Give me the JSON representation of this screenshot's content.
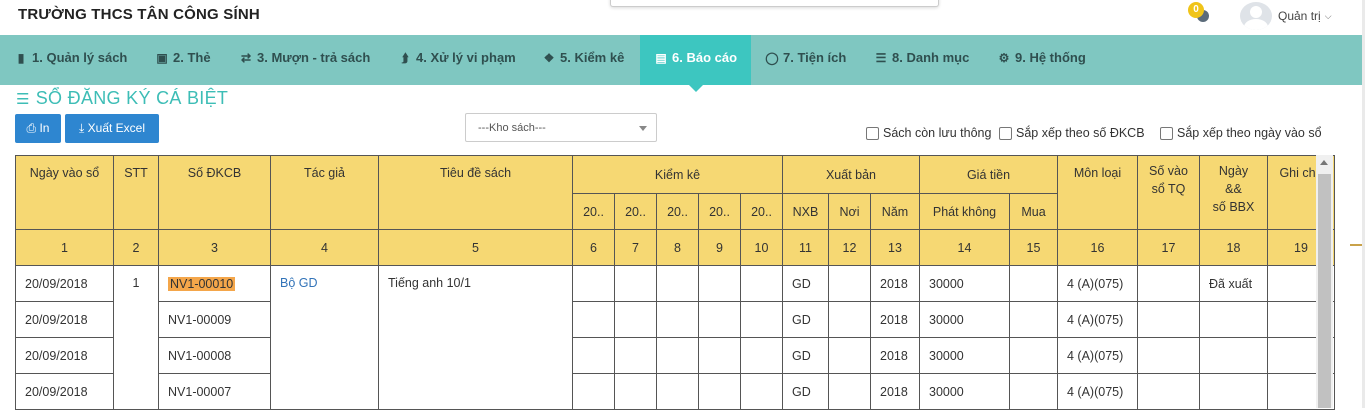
{
  "app": {
    "school_name": "TRƯỜNG THCS TÂN CÔNG SÍNH"
  },
  "header": {
    "notification_count": "0",
    "user_name": "Quản trị"
  },
  "nav": {
    "items": [
      {
        "label": "1. Quản lý sách",
        "icon": "book-icon"
      },
      {
        "label": "2. Thẻ",
        "icon": "card-icon"
      },
      {
        "label": "3. Mượn - trả sách",
        "icon": "exchange-icon"
      },
      {
        "label": "4. Xử lý vi phạm",
        "icon": "bolt-icon"
      },
      {
        "label": "5. Kiểm kê",
        "icon": "cubes-icon"
      },
      {
        "label": "6. Báo cáo",
        "icon": "bar-chart-icon",
        "active": true
      },
      {
        "label": "7. Tiện ích",
        "icon": "lightbulb-icon"
      },
      {
        "label": "8. Danh mục",
        "icon": "list-icon"
      },
      {
        "label": "9. Hệ thống",
        "icon": "gear-icon"
      }
    ]
  },
  "page": {
    "title": "SỔ ĐĂNG KÝ CÁ BIỆT"
  },
  "toolbar": {
    "print_label": "In",
    "export_label": "Xuất Excel",
    "warehouse_select": "---Kho sách---",
    "opt_circulating": "Sách còn lưu thông",
    "opt_sort_dkcb": "Sắp xếp theo số ĐKCB",
    "opt_sort_date": "Sắp xếp theo ngày vào sổ"
  },
  "table": {
    "headers": {
      "ngay_vao_so": "Ngày vào sổ",
      "stt": "STT",
      "so_dkcb": "Số ĐKCB",
      "tac_gia": "Tác giả",
      "tieu_de": "Tiêu đề sách",
      "kiem_ke": "Kiểm kê",
      "kk_cols": [
        "20..",
        "20..",
        "20..",
        "20..",
        "20.."
      ],
      "xuat_ban": "Xuất bản",
      "nxb": "NXB",
      "noi": "Nơi",
      "nam": "Năm",
      "gia_tien": "Giá tiền",
      "phat_khong": "Phát không",
      "mua": "Mua",
      "mon_loai": "Môn loại",
      "so_vao_so_tq_1": "Số vào",
      "so_vao_so_tq_2": "sổ TQ",
      "ngay_bbx_1": "Ngày",
      "ngay_bbx_2": "&&",
      "ngay_bbx_3": "số BBX",
      "ghi_chu": "Ghi chú"
    },
    "col_numbers": [
      "1",
      "2",
      "3",
      "4",
      "5",
      "6",
      "7",
      "8",
      "9",
      "10",
      "11",
      "12",
      "13",
      "14",
      "15",
      "16",
      "17",
      "18",
      "19"
    ],
    "group": {
      "stt": "1",
      "author": "Bộ GD",
      "title": "Tiếng anh 10/1"
    },
    "rows": [
      {
        "date": "20/09/2018",
        "dkcb": "NV1-00010",
        "nxb": "GD",
        "year": "2018",
        "price": "30000",
        "mon_loai": "4 (A)(075)",
        "ngay_bbx": "Đã xuất"
      },
      {
        "date": "20/09/2018",
        "dkcb": "NV1-00009",
        "nxb": "GD",
        "year": "2018",
        "price": "30000",
        "mon_loai": "4 (A)(075)",
        "ngay_bbx": ""
      },
      {
        "date": "20/09/2018",
        "dkcb": "NV1-00008",
        "nxb": "GD",
        "year": "2018",
        "price": "30000",
        "mon_loai": "4 (A)(075)",
        "ngay_bbx": ""
      },
      {
        "date": "20/09/2018",
        "dkcb": "NV1-00007",
        "nxb": "GD",
        "year": "2018",
        "price": "30000",
        "mon_loai": "4 (A)(075)",
        "ngay_bbx": ""
      }
    ]
  }
}
